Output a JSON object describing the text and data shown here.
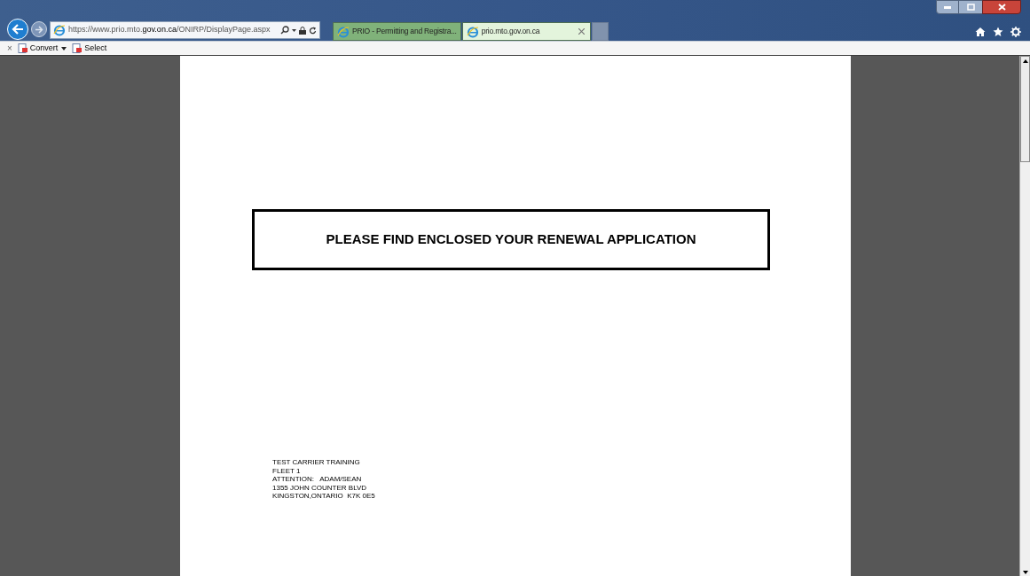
{
  "address_bar": {
    "url": "https://www.prio.mto.**gov.on.ca**/ONIRP/DisplayPage.aspx"
  },
  "tabs": [
    {
      "label": "PRIO - Permitting and Registra...",
      "selected": false,
      "closable": false
    },
    {
      "label": "prio.mto.gov.on.ca",
      "selected": true,
      "closable": true
    }
  ],
  "toolbar": {
    "close": "×",
    "items": [
      {
        "label": "Convert",
        "dropdown": true
      },
      {
        "label": "Select",
        "dropdown": false
      }
    ]
  },
  "document": {
    "heading": "PLEASE FIND ENCLOSED YOUR RENEWAL APPLICATION",
    "address_lines": [
      "TEST CARRIER TRAINING",
      "FLEET 1",
      "ATTENTION:   ADAM/SEAN",
      "1355 JOHN COUNTER BLVD",
      "KINGSTON,ONTARIO  K7K 0E5"
    ]
  }
}
